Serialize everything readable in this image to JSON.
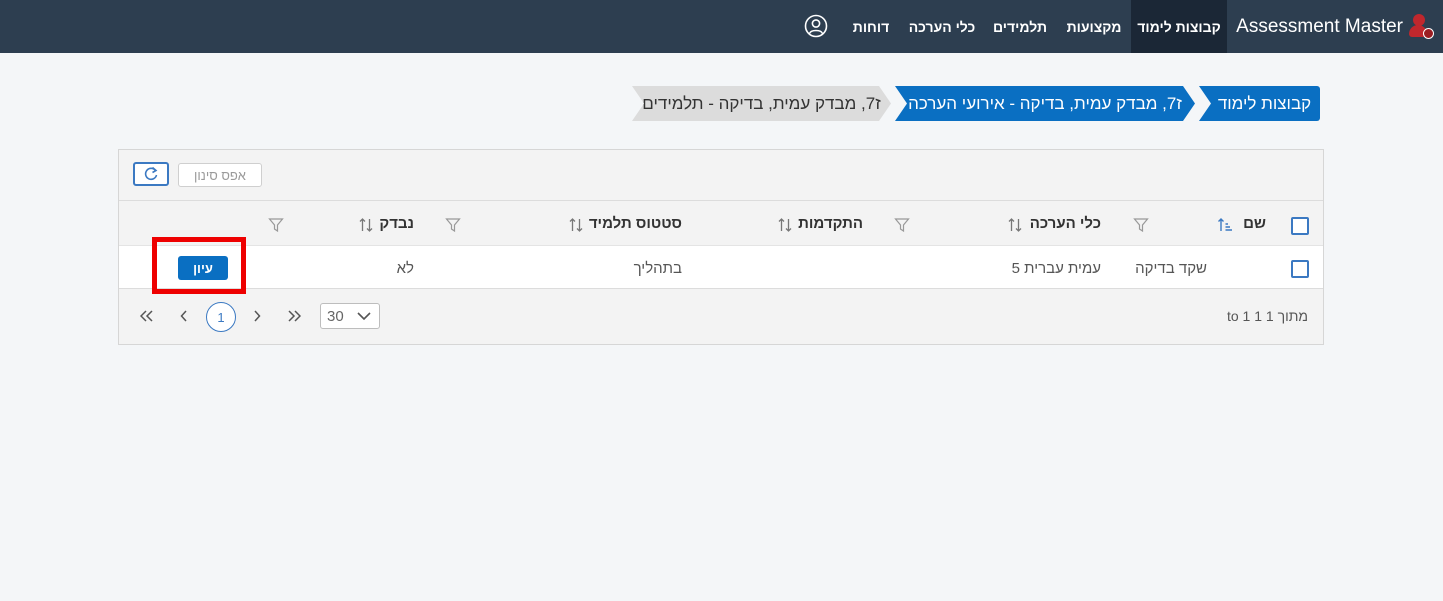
{
  "app": {
    "brand": "Assessment Master",
    "nav": [
      {
        "label": "קבוצות לימוד",
        "active": true
      },
      {
        "label": "מקצועות"
      },
      {
        "label": "תלמידים"
      },
      {
        "label": "כלי הערכה"
      },
      {
        "label": "דוחות"
      }
    ],
    "user_icon": "user-circle-icon"
  },
  "breadcrumb": [
    {
      "label": "קבוצות לימוד"
    },
    {
      "label": "ז7, מבדק עמית, בדיקה - אירועי הערכה"
    },
    {
      "label": "ז7, מבדק עמית, בדיקה - תלמידים"
    }
  ],
  "toolbar": {
    "refresh_icon": "refresh-icon",
    "reset_filter_label": "אפס סינון"
  },
  "table": {
    "columns": [
      "שם",
      "כלי הערכה",
      "התקדמות",
      "סטטוס תלמיד",
      "נבדק"
    ],
    "rows": [
      {
        "name": "שקד בדיקה",
        "assessment_tool": "עמית עברית 5",
        "progress": "",
        "status": "בתהליך",
        "checked": "לא",
        "action_label": "עיון"
      }
    ]
  },
  "pager": {
    "current_page": "1",
    "page_size": "30",
    "range_text": "מתוך 1 1 to 1"
  },
  "colors": {
    "topbar": "#2d3e50",
    "accent": "#0a6fc2",
    "highlight": "#ee0000"
  }
}
